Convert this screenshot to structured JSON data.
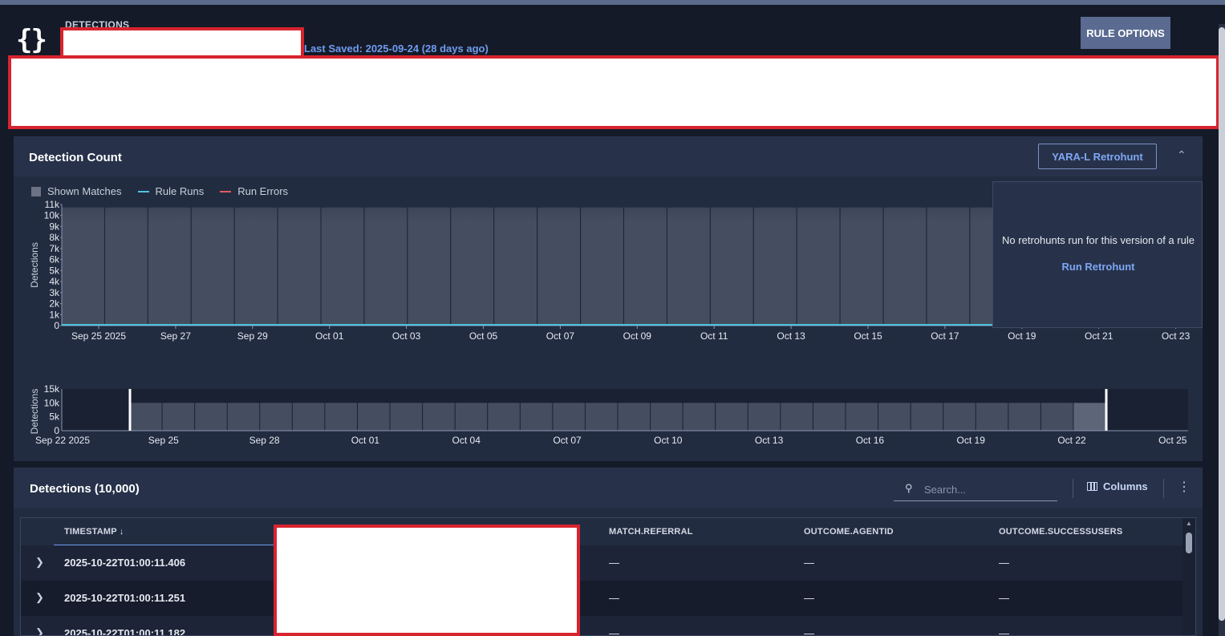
{
  "header": {
    "breadcrumb": "DETECTIONS",
    "last_saved": "Last Saved: 2025-09-24 (28 days ago)",
    "rule_options": "RULE OPTIONS",
    "logo_icon": "curly-braces-icon"
  },
  "detection_count": {
    "title": "Detection Count",
    "retrohunt_button": "YARA-L Retrohunt",
    "legend": [
      "Shown Matches",
      "Rule Runs",
      "Run Errors"
    ],
    "retro_message": "No retrohunts run for this version of a rule",
    "retro_link": "Run Retrohunt",
    "colors": {
      "matches": "#6a7284",
      "rule_runs": "#4fc3e0",
      "run_errors": "#e05a64"
    }
  },
  "chart_data": [
    {
      "type": "bar",
      "ylabel": "Detections",
      "y_ticks": [
        "0",
        "1k",
        "2k",
        "3k",
        "4k",
        "5k",
        "6k",
        "7k",
        "8k",
        "9k",
        "10k",
        "11k"
      ],
      "ylim": [
        0,
        11000
      ],
      "x_ticks": [
        "Sep 25 2025",
        "Sep 27",
        "Sep 29",
        "Oct 01",
        "Oct 03",
        "Oct 05",
        "Oct 07",
        "Oct 09",
        "Oct 11",
        "Oct 13",
        "Oct 15",
        "Oct 17",
        "Oct 19",
        "Oct 21",
        "Oct 23"
      ],
      "series": [
        {
          "name": "Shown Matches",
          "values": [
            10000,
            10000,
            10000,
            10000,
            10000,
            10000,
            10000,
            10000,
            10000,
            10000,
            10000,
            10000,
            10000,
            10000,
            10000,
            10000,
            10000,
            10000,
            10000,
            10000,
            10000,
            10000,
            10000,
            10000,
            10000,
            10000
          ]
        },
        {
          "name": "Rule Runs",
          "values": [
            0
          ]
        }
      ]
    },
    {
      "type": "bar",
      "ylabel": "Detections",
      "y_ticks": [
        "0",
        "5k",
        "10k",
        "15k"
      ],
      "ylim": [
        0,
        15000
      ],
      "x_ticks": [
        "Sep 22 2025",
        "Sep 25",
        "Sep 28",
        "Oct 01",
        "Oct 04",
        "Oct 07",
        "Oct 10",
        "Oct 13",
        "Oct 16",
        "Oct 19",
        "Oct 22",
        "Oct 25"
      ],
      "values": [
        10000,
        10000,
        10000,
        10000,
        10000,
        10000,
        10000,
        10000,
        10000,
        10000,
        10000,
        10000,
        10000,
        10000,
        10000,
        10000,
        10000,
        10000,
        10000,
        10000,
        10000,
        10000,
        10000,
        10000,
        10000,
        10000,
        10000,
        10000,
        10000,
        10000
      ]
    }
  ],
  "detections": {
    "title": "Detections (10,000)",
    "search_placeholder": "Search...",
    "columns_label": "Columns",
    "headers": [
      "TIMESTAMP ↓",
      "MATCH.REFERRAL",
      "OUTCOME.AGENTID",
      "OUTCOME.SUCCESSUSERS"
    ],
    "rows": [
      {
        "timestamp": "2025-10-22T01:00:11.406",
        "referral": "—",
        "agentid": "—",
        "successusers": "—"
      },
      {
        "timestamp": "2025-10-22T01:00:11.251",
        "referral": "—",
        "agentid": "—",
        "successusers": "—"
      },
      {
        "timestamp": "2025-10-22T01:00:11.182",
        "referral": "—",
        "agentid": "—",
        "successusers": "—"
      }
    ]
  }
}
